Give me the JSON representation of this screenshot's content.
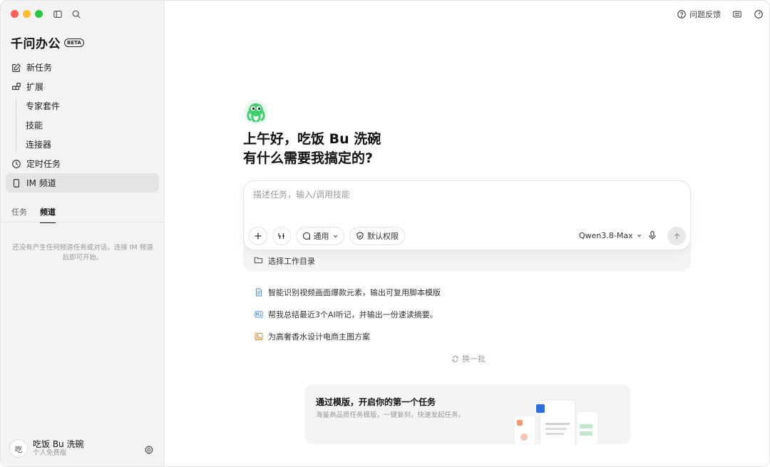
{
  "app": {
    "name": "千问办公",
    "badge": "BETA"
  },
  "nav": {
    "new_task": "新任务",
    "extensions": "扩展",
    "sub_items": [
      "专家套件",
      "技能",
      "连接器"
    ],
    "scheduled": "定时任务",
    "im_channel": "IM 频道"
  },
  "tabs": [
    "任务",
    "频道"
  ],
  "empty_hint": "还没有产生任何频道任务或对话，连接 IM 频道后即可开始。",
  "user": {
    "avatar": "吃",
    "name": "吃饭 Bu 洗碗",
    "plan": "个人免费版"
  },
  "header": {
    "feedback": "问题反馈"
  },
  "greeting": {
    "line1": "上午好，吃饭 Bu 洗碗",
    "line2": "有什么需要我搞定的?"
  },
  "composer": {
    "placeholder": "描述任务，输入/调用技能",
    "mode_label": "通用",
    "permission_label": "默认权限",
    "model": "Qwen3.8-Max"
  },
  "workdir": {
    "label": "选择工作目录"
  },
  "suggestions": [
    {
      "icon": "document-icon",
      "text": "智能识别视频画面爆款元素，输出可复用脚本模版"
    },
    {
      "icon": "markdown-icon",
      "text": "帮我总结最近3个AI听记，并输出一份速读摘要。"
    },
    {
      "icon": "image-icon",
      "text": "为高奢香水设计电商主图方案"
    }
  ],
  "refresh_label": "换一批",
  "template_card": {
    "title": "通过模版，开启你的第一个任务",
    "desc": "海量高品质任务模版，一键复刻，快速发起任务。"
  },
  "colors": {
    "accent_green": "#3ecf6e",
    "sidebar_bg": "#f3f3f4",
    "doc_blue": "#4a90e2",
    "image_orange": "#e88a3c"
  }
}
